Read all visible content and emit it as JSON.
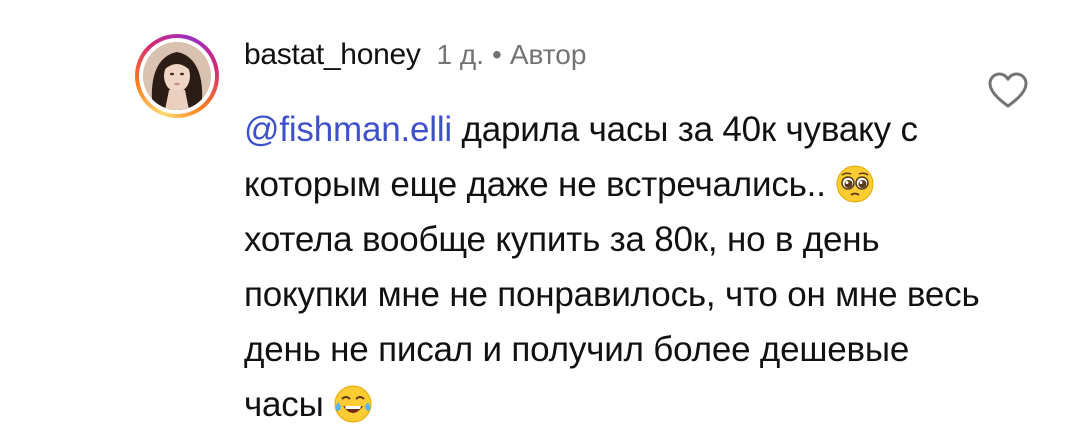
{
  "comment": {
    "username": "bastat_honey",
    "time": "1 д.",
    "separator": "•",
    "author_label": "Автор",
    "mention": "@fishman.elli",
    "text_part1": " дарила часы за 40к чуваку с которым еще даже не встречались.. ",
    "emoji1": "pleading-face",
    "text_part2": " хотела вообще купить за 80к, но в день покупки мне не понравилось, что он мне весь день не писал и получил более дешевые часы ",
    "emoji2": "tears-of-joy",
    "like_icon": "heart-outline-icon"
  },
  "colors": {
    "mention": "#3f51c9",
    "meta": "#737373",
    "text": "#111111",
    "ring": [
      "#feda75",
      "#fa7e1e",
      "#d62976",
      "#962fbf"
    ]
  }
}
